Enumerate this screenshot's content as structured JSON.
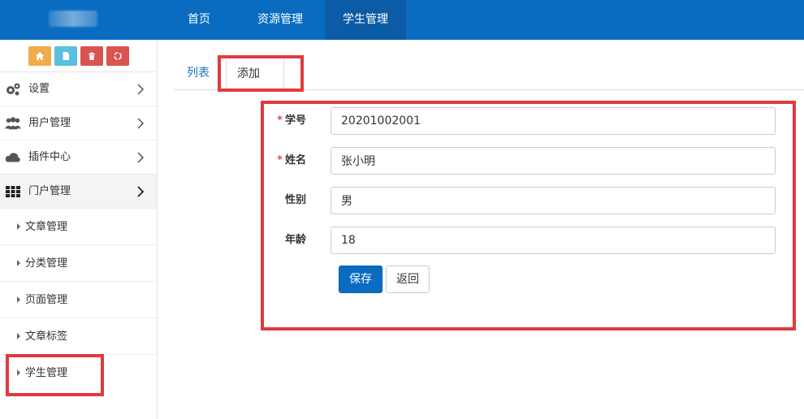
{
  "topnav": {
    "items": [
      {
        "label": "首页"
      },
      {
        "label": "资源管理"
      },
      {
        "label": "学生管理",
        "active": true
      }
    ],
    "bg_color": "#0a6cc1"
  },
  "shortcuts": [
    {
      "icon": "home-icon",
      "color": "#f0ad4e"
    },
    {
      "icon": "file-icon",
      "color": "#5bc0de"
    },
    {
      "icon": "trash-icon",
      "color": "#d9534f"
    },
    {
      "icon": "recycle-icon",
      "color": "#d9534f"
    }
  ],
  "sidebar": {
    "items": [
      {
        "label": "设置",
        "icon": "gears-icon"
      },
      {
        "label": "用户管理",
        "icon": "users-icon"
      },
      {
        "label": "插件中心",
        "icon": "cloud-icon"
      },
      {
        "label": "门户管理",
        "icon": "grid-icon",
        "open": true
      }
    ],
    "subitems": [
      {
        "label": "文章管理"
      },
      {
        "label": "分类管理"
      },
      {
        "label": "页面管理"
      },
      {
        "label": "文章标签"
      },
      {
        "label": "学生管理"
      }
    ]
  },
  "tabs": {
    "list": "列表",
    "add": "添加"
  },
  "form": {
    "fields": [
      {
        "label": "学号",
        "required": true,
        "value": "20201002001"
      },
      {
        "label": "姓名",
        "required": true,
        "value": "张小明"
      },
      {
        "label": "性别",
        "required": false,
        "value": "男"
      },
      {
        "label": "年龄",
        "required": false,
        "value": "18"
      }
    ],
    "required_mark": "*",
    "save_label": "保存",
    "back_label": "返回"
  }
}
